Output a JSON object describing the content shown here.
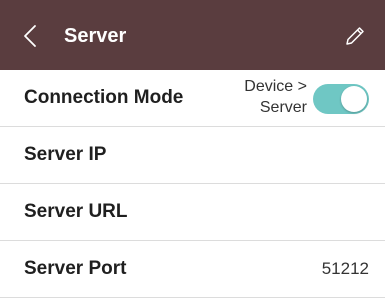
{
  "header": {
    "title": "Server",
    "back_icon": "chevron-left-icon",
    "edit_icon": "pencil-icon",
    "background_color": "#5a3d3f"
  },
  "rows": [
    {
      "label": "Connection Mode",
      "value_line1": "Device >",
      "value_line2": "Server",
      "toggle_on": true,
      "toggle_color": "#6fc7c4"
    },
    {
      "label": "Server IP",
      "value": ""
    },
    {
      "label": "Server URL",
      "value": ""
    },
    {
      "label": "Server Port",
      "value": "51212"
    }
  ]
}
